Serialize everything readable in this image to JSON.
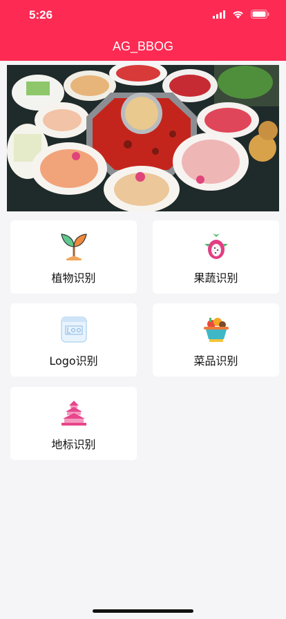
{
  "status_bar": {
    "time": "5:26"
  },
  "nav": {
    "title": "AG_BBOG"
  },
  "banner": {
    "icon": "hotpot-photo"
  },
  "cards": [
    {
      "label": "植物识别",
      "icon": "plant-icon"
    },
    {
      "label": "果蔬识别",
      "icon": "dragonfruit-icon"
    },
    {
      "label": "Logo识别",
      "icon": "logo-icon"
    },
    {
      "label": "菜品识别",
      "icon": "dish-icon"
    },
    {
      "label": "地标识别",
      "icon": "temple-icon"
    }
  ],
  "colors": {
    "brand": "#fd2a53",
    "background": "#f5f5f7"
  }
}
